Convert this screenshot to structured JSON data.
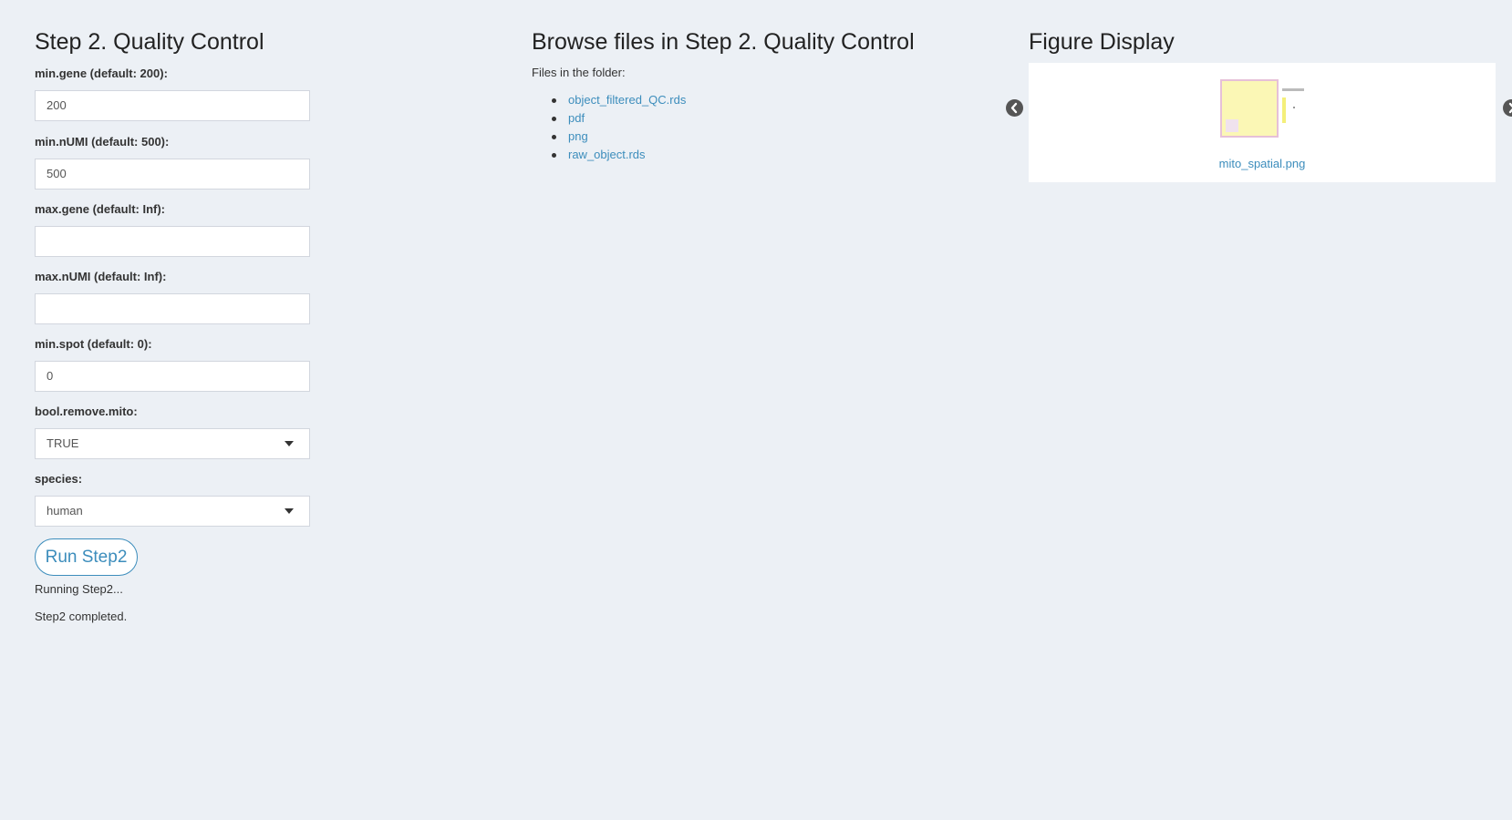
{
  "left": {
    "title": "Step 2. Quality Control",
    "fields": [
      {
        "label": "min.gene (default: 200):",
        "value": "200"
      },
      {
        "label": "min.nUMI (default: 500):",
        "value": "500"
      },
      {
        "label": "max.gene (default: Inf):",
        "value": ""
      },
      {
        "label": "max.nUMI (default: Inf):",
        "value": ""
      },
      {
        "label": "min.spot (default: 0):",
        "value": "0"
      }
    ],
    "selects": [
      {
        "label": "bool.remove.mito:",
        "value": "TRUE"
      },
      {
        "label": "species:",
        "value": "human"
      }
    ],
    "run_button": "Run Step2",
    "status": [
      "Running Step2...",
      "Step2 completed."
    ]
  },
  "middle": {
    "title": "Browse files in Step 2. Quality Control",
    "subtitle": "Files in the folder:",
    "files": [
      "object_filtered_QC.rds",
      "pdf",
      "png",
      "raw_object.rds"
    ]
  },
  "right": {
    "title": "Figure Display",
    "caption": "mito_spatial.png",
    "icons": {
      "prev": "chevron-left-circle-icon",
      "next": "chevron-right-circle-icon"
    }
  }
}
